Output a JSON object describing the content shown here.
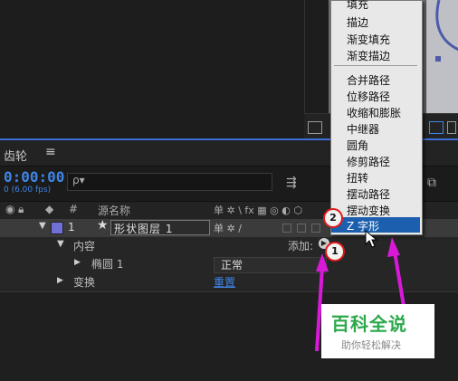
{
  "menu": {
    "items": [
      "填充",
      "描边",
      "渐变填充",
      "渐变描边",
      "合并路径",
      "位移路径",
      "收缩和膨胀",
      "中继器",
      "圆角",
      "修剪路径",
      "扭转",
      "摆动路径",
      "摆动变换",
      "Z 字形"
    ],
    "selected": "Z 字形"
  },
  "panel": {
    "tab_title": "齿轮",
    "menu_glyph": "≡",
    "timecode": "0:00:00",
    "fps": "0 (6.00 fps)",
    "search_glyph": "ρ▾"
  },
  "columns": {
    "hash": "#",
    "source_name": "源名称",
    "switches": "单 ✲ \\ fx ▦ ◎ ◐ ⬡"
  },
  "layer": {
    "number": "1",
    "name": "形状图层 1",
    "color": "#6f70d6",
    "switch_glyphs": "单 ✲ /"
  },
  "rows": {
    "content_label": "内容",
    "add_label": "添加:",
    "ellipse_label": "椭圆 1",
    "blend_mode": "正常",
    "transform_label": "变换",
    "reset_link": "重置"
  },
  "annotations": {
    "badge1": "1",
    "badge2": "2",
    "arrow_color": "#d81ad8"
  },
  "watermark": {
    "title": "百科全说",
    "subtitle": "助你轻松解决"
  },
  "colors": {
    "accent_blue": "#3f84e5",
    "selection": "#1b5fae"
  }
}
